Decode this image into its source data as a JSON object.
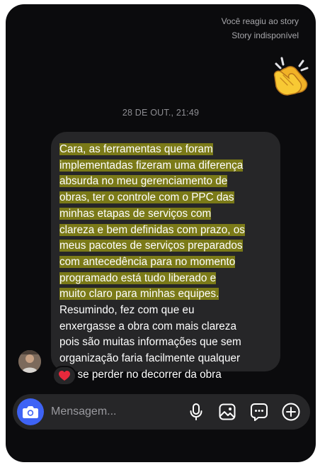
{
  "status": {
    "reacted": "Você reagiu ao story",
    "unavailable": "Story indisponível"
  },
  "reaction": {
    "emoji_icon": "clapping-hands-icon"
  },
  "timestamp": "28 DE OUT., 21:49",
  "message": {
    "highlighted_lines": [
      "Cara, as ferramentas que foram",
      "implementadas fizeram uma diferença",
      "absurda no meu gerenciamento de",
      "obras, ter o controle com o PPC das",
      "minhas etapas de serviços com",
      "clareza e bem definidas com prazo, os",
      "meus pacotes de serviços preparados",
      "com antecedência para no momento",
      "programado está tudo liberado e",
      "muito claro para minhas equipes."
    ],
    "plain_lines": [
      "Resumindo, fez com que eu",
      "enxergasse a obra com mais clareza",
      "pois são muitas informações que sem",
      "organização faria facilmente qualquer",
      "um se perder no decorrer da obra"
    ],
    "reaction_icon": "red-heart-icon"
  },
  "composer": {
    "placeholder": "Mensagem..."
  },
  "colors": {
    "background": "#0b0b0d",
    "bubble": "#262628",
    "highlight": "#7b7a18",
    "camera_button": "#3e63f5",
    "heart": "#e8293c"
  }
}
